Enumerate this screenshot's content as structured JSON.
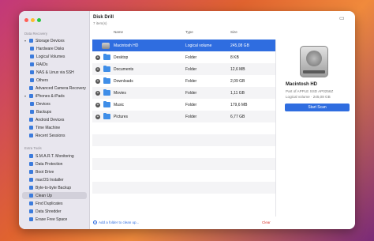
{
  "app": {
    "title": "Disk Drill",
    "subtitle": "7 item(s)"
  },
  "colors": {
    "accent": "#2f6de0",
    "danger": "#d9322a",
    "traffic_red": "#ff5f57",
    "traffic_yellow": "#febc2e",
    "traffic_green": "#28c840"
  },
  "sidebar": {
    "section_recovery": "Data Recovery",
    "section_extra": "Extra Tools",
    "recovery_items": [
      {
        "label": "Storage Devices",
        "icon": "storage-icon"
      },
      {
        "label": "Hardware Disks",
        "icon": "disk-icon"
      },
      {
        "label": "Logical Volumes",
        "icon": "volume-icon"
      },
      {
        "label": "RAIDs",
        "icon": "raid-icon"
      },
      {
        "label": "NAS & Linux via SSH",
        "icon": "network-icon"
      },
      {
        "label": "Others",
        "icon": "other-icon"
      },
      {
        "label": "Advanced Camera Recovery",
        "icon": "camera-icon"
      },
      {
        "label": "iPhones & iPads",
        "icon": "phone-icon"
      },
      {
        "label": "Devices",
        "icon": "device-icon"
      },
      {
        "label": "Backups",
        "icon": "backup-icon"
      },
      {
        "label": "Android Devices",
        "icon": "android-icon"
      },
      {
        "label": "Time Machine",
        "icon": "time-machine-icon"
      },
      {
        "label": "Recent Sessions",
        "icon": "clock-icon"
      }
    ],
    "extra_items": [
      {
        "label": "S.M.A.R.T. Monitoring",
        "icon": "monitor-icon"
      },
      {
        "label": "Data Protection",
        "icon": "shield-icon"
      },
      {
        "label": "Boot Drive",
        "icon": "boot-icon"
      },
      {
        "label": "macOS Installer",
        "icon": "installer-icon"
      },
      {
        "label": "Byte-to-byte Backup",
        "icon": "backup-icon"
      },
      {
        "label": "Clean Up",
        "icon": "broom-icon"
      },
      {
        "label": "Find Duplicates",
        "icon": "duplicate-icon"
      },
      {
        "label": "Data Shredder",
        "icon": "shredder-icon"
      },
      {
        "label": "Erase Free Space",
        "icon": "erase-icon"
      }
    ]
  },
  "table": {
    "columns": [
      "Name",
      "Type",
      "Size"
    ],
    "rows": [
      {
        "name": "Macintosh HD",
        "type": "Logical volume",
        "size": "245,08 GB"
      },
      {
        "name": "Desktop",
        "type": "Folder",
        "size": "8 KB"
      },
      {
        "name": "Documents",
        "type": "Folder",
        "size": "12,6 MB"
      },
      {
        "name": "Downloads",
        "type": "Folder",
        "size": "2,09 GB"
      },
      {
        "name": "Movies",
        "type": "Folder",
        "size": "1,11 GB"
      },
      {
        "name": "Music",
        "type": "Folder",
        "size": "179,6 MB"
      },
      {
        "name": "Pictures",
        "type": "Folder",
        "size": "6,77 GB"
      }
    ]
  },
  "footer": {
    "add_label": "Add a folder to clean up...",
    "clear_label": "Clear"
  },
  "detail": {
    "name": "Macintosh HD",
    "line1": "Part of APPLE SSD AP0256Z",
    "line2": "Logical volume · 245,08 GB",
    "scan_button": "Start Scan"
  }
}
